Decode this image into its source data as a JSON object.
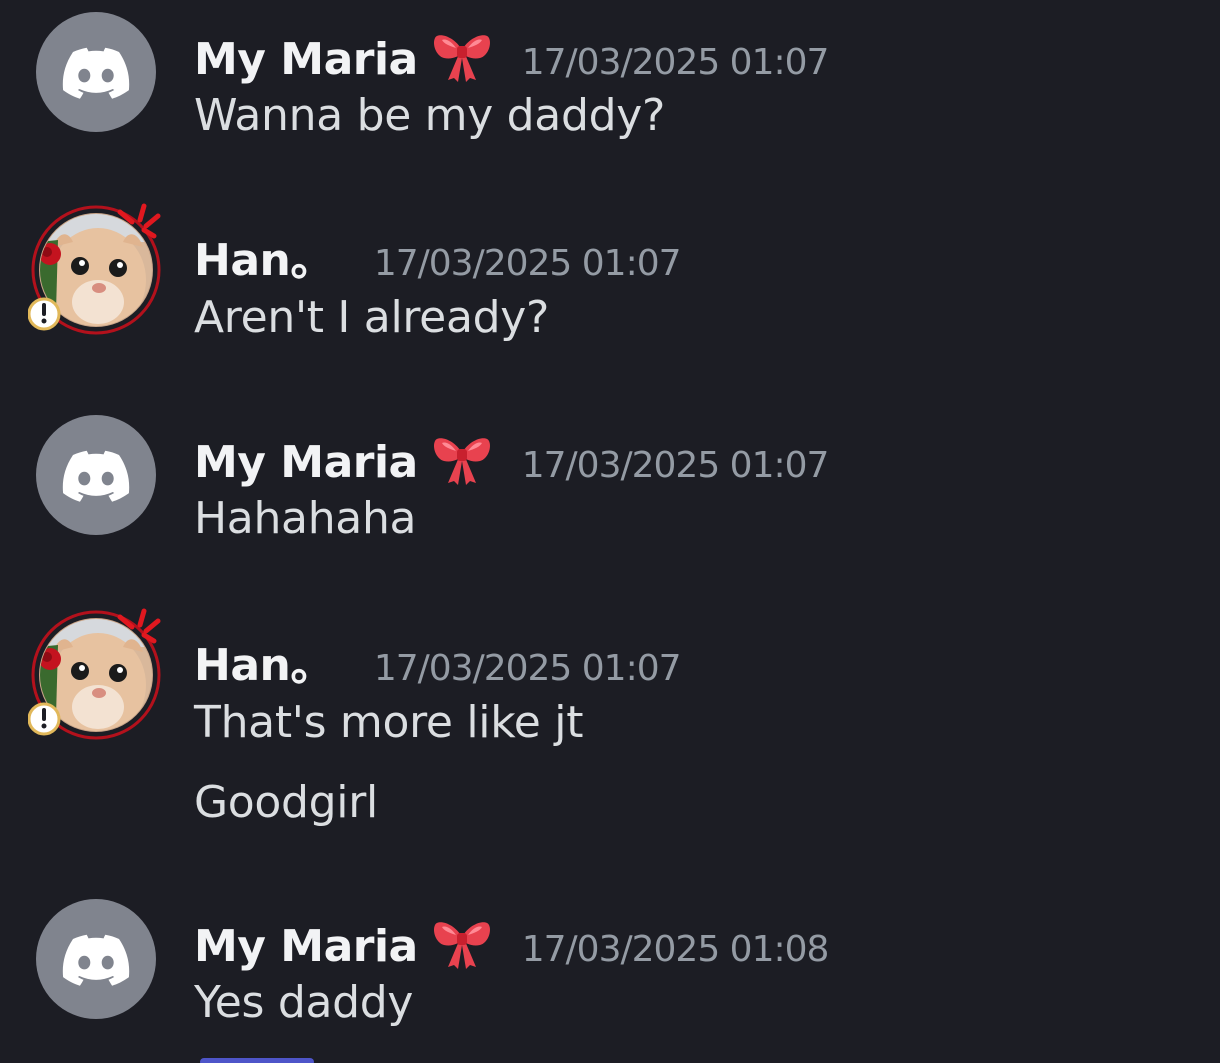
{
  "messages": [
    {
      "author": "My Maria",
      "timestamp": "17/03/2025 01:07",
      "lines": [
        "Wanna be my daddy?"
      ]
    },
    {
      "author": "Han。",
      "timestamp": "17/03/2025 01:07",
      "lines": [
        "Aren't I already?"
      ]
    },
    {
      "author": "My Maria",
      "timestamp": "17/03/2025 01:07",
      "lines": [
        "Hahahaha"
      ]
    },
    {
      "author": "Han。",
      "timestamp": "17/03/2025 01:07",
      "lines": [
        "That's more like jt",
        "Goodgirl"
      ]
    },
    {
      "author": "My Maria",
      "timestamp": "17/03/2025 01:08",
      "lines": [
        "Yes daddy"
      ]
    }
  ],
  "colors": {
    "background": "#1c1d24",
    "username": "#f2f3f5",
    "timestamp": "#949ba4",
    "message_text": "#dbdee1",
    "default_avatar": "#80848e"
  },
  "icons": {
    "default_avatar": "discord-logo-icon",
    "name_decoration": "ribbon-bow-icon",
    "cat_avatar": "cat-photo-avatar",
    "avatar_badge": "exclamation-icon"
  }
}
